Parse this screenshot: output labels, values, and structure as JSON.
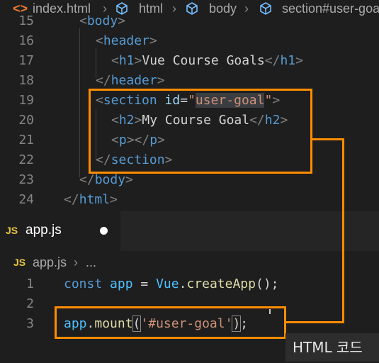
{
  "top_editor": {
    "breadcrumb": {
      "file": "index.html",
      "items": [
        "html",
        "body",
        "section#user-goal"
      ]
    },
    "line_numbers": [
      "15",
      "16",
      "17",
      "18",
      "19",
      "20",
      "21",
      "22",
      "23",
      "24"
    ],
    "lines": {
      "l15_tag": "body",
      "l16_tag": "header",
      "l17_tag": "h1",
      "l17_text": "Vue Course Goals",
      "l18_tag": "header",
      "l19_tag": "section",
      "l19_attr": "id",
      "l19_value": "user-goal",
      "l20_tag": "h2",
      "l20_text": "My Course Goal",
      "l21_tag": "p",
      "l22_tag": "section",
      "l23_tag": "body",
      "l24_tag": "html"
    }
  },
  "tab": {
    "icon_label": "JS",
    "label": "app.js",
    "unsaved_indicator": "●"
  },
  "bottom_editor": {
    "breadcrumb": {
      "icon_label": "JS",
      "file": "app.js",
      "more": "..."
    },
    "line_numbers": [
      "1",
      "2",
      "3"
    ],
    "line1": {
      "keyword": "const",
      "variable": "app",
      "operator": "=",
      "object": "Vue",
      "method": "createApp",
      "args": "()",
      "end": ";"
    },
    "line3": {
      "object": "app",
      "method": "mount",
      "arg": "'#user-goal'",
      "end": ";"
    }
  },
  "tooltip": {
    "text": "HTML 코드"
  },
  "colors": {
    "accent_annotation": "#ff8c00",
    "tag": "#569cd6",
    "string": "#ce9178",
    "attribute": "#9cdcfe",
    "function": "#dcdcaa"
  }
}
